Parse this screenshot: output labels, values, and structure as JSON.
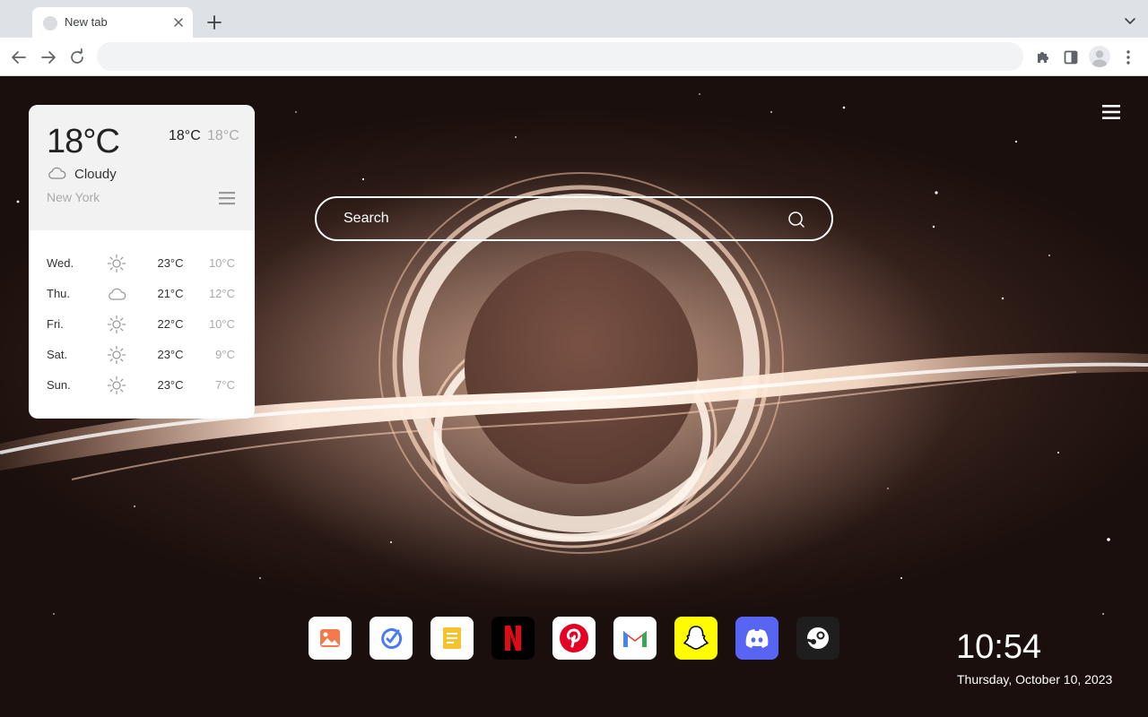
{
  "browser": {
    "tab_title": "New tab",
    "omnibox_value": ""
  },
  "weather": {
    "current_temp": "18°C",
    "high": "18°C",
    "low": "18°C",
    "condition": "Cloudy",
    "condition_icon": "cloud-icon",
    "city": "New York",
    "forecast": [
      {
        "day": "Wed.",
        "icon": "sun-icon",
        "high": "23°C",
        "low": "10°C"
      },
      {
        "day": "Thu.",
        "icon": "cloud-icon",
        "high": "21°C",
        "low": "12°C"
      },
      {
        "day": "Fri.",
        "icon": "sun-icon",
        "high": "22°C",
        "low": "10°C"
      },
      {
        "day": "Sat.",
        "icon": "sun-icon",
        "high": "23°C",
        "low": "9°C"
      },
      {
        "day": "Sun.",
        "icon": "sun-icon",
        "high": "23°C",
        "low": "7°C"
      }
    ]
  },
  "search": {
    "placeholder": "Search"
  },
  "shortcuts": [
    {
      "name": "gallery",
      "icon": "image-icon",
      "color": "#f06a3c"
    },
    {
      "name": "tasks",
      "icon": "check-circle-icon",
      "color": "#4a7bf5"
    },
    {
      "name": "notes",
      "icon": "note-icon",
      "color": "#f4c430"
    },
    {
      "name": "netflix",
      "icon": "netflix-icon",
      "color": "#e50914"
    },
    {
      "name": "pinterest",
      "icon": "pinterest-icon",
      "color": "#e60023"
    },
    {
      "name": "gmail",
      "icon": "gmail-icon",
      "color": "#ea4335"
    },
    {
      "name": "snapchat",
      "icon": "snapchat-icon",
      "color": "#fffc00"
    },
    {
      "name": "discord",
      "icon": "discord-icon",
      "color": "#5865f2"
    },
    {
      "name": "steam",
      "icon": "steam-icon",
      "color": "#1b2838"
    }
  ],
  "clock": {
    "time": "10:54",
    "date": "Thursday, October 10, 2023"
  }
}
